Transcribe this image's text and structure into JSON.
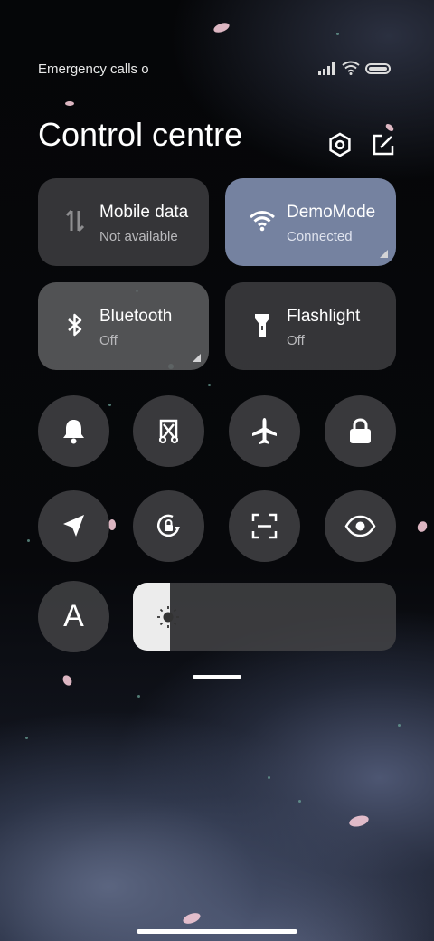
{
  "status_bar": {
    "text": "Emergency calls o",
    "icons": [
      "signal-icon",
      "wifi-icon",
      "battery-icon"
    ]
  },
  "header": {
    "title": "Control centre",
    "buttons": [
      "settings-icon",
      "edit-icon"
    ]
  },
  "tiles": [
    {
      "name": "Mobile data",
      "status": "Not available",
      "icon": "mobile-data-icon",
      "active": false
    },
    {
      "name": "DemoMode",
      "status": "Connected",
      "icon": "wifi-icon",
      "active": true
    },
    {
      "name": "Bluetooth",
      "status": "Off",
      "icon": "bluetooth-icon",
      "active": false
    },
    {
      "name": "Flashlight",
      "status": "Off",
      "icon": "flashlight-icon",
      "active": false
    }
  ],
  "toggles": [
    "bell-icon",
    "screenshot-icon",
    "airplane-icon",
    "lock-icon",
    "location-icon",
    "rotation-lock-icon",
    "scan-icon",
    "eye-icon"
  ],
  "font_size_button": "A",
  "brightness": {
    "level": 0.14,
    "icon": "brightness-icon"
  },
  "colors": {
    "accent": "#7582a0",
    "tile": "#464648"
  }
}
